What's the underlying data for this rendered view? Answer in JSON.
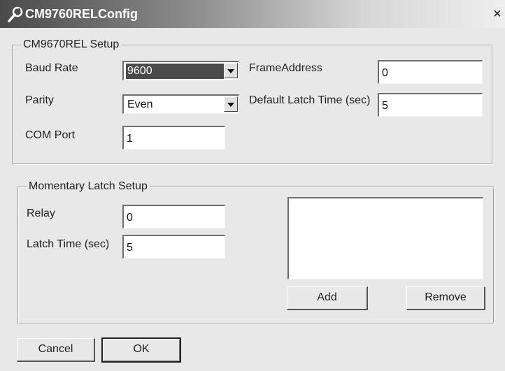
{
  "window": {
    "title": "CM9760RELConfig",
    "close_label": "×"
  },
  "setup_group": {
    "title": "CM9670REL Setup",
    "baud_rate": {
      "label": "Baud Rate",
      "value": "9600"
    },
    "parity": {
      "label": "Parity",
      "value": "Even"
    },
    "com_port": {
      "label": "COM Port",
      "value": "1"
    },
    "frame_address": {
      "label": "FrameAddress",
      "value": "0"
    },
    "default_latch_time": {
      "label": "Default Latch Time (sec)",
      "value": "5"
    }
  },
  "latch_group": {
    "title": "Momentary Latch Setup",
    "relay": {
      "label": "Relay",
      "value": "0"
    },
    "latch_time": {
      "label": "Latch Time (sec)",
      "value": "5"
    },
    "add_label": "Add",
    "remove_label": "Remove"
  },
  "footer": {
    "cancel_label": "Cancel",
    "ok_label": "OK"
  },
  "icons": {
    "title_icon": "wrench-icon",
    "combo_arrow": "chevron-down-icon"
  }
}
